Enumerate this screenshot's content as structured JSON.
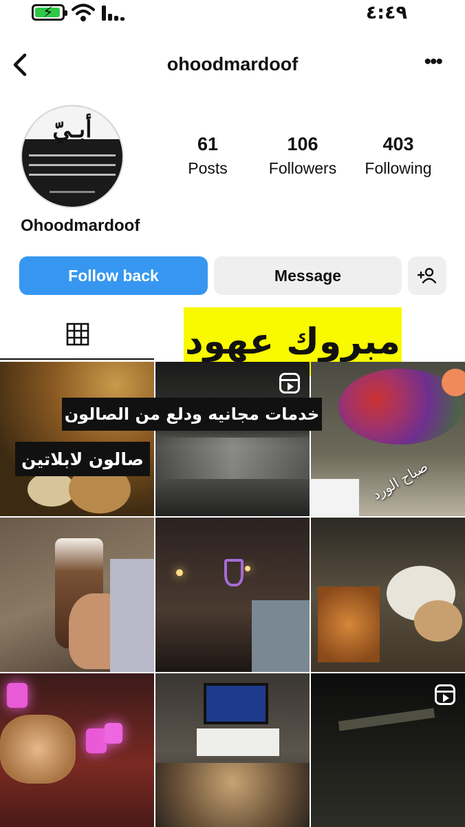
{
  "status_bar": {
    "time": "٤:٤٩",
    "battery_level": 0.85,
    "battery_charging": true,
    "icons": [
      "battery-icon",
      "wifi-icon",
      "cellular-signal-icon"
    ]
  },
  "header": {
    "username": "ohoodmardoof",
    "icons": [
      "back-arrow-icon",
      "more-options-icon"
    ]
  },
  "profile": {
    "avatar_text": "أبـيّ",
    "display_name": "Ohoodmardoof",
    "stats": [
      {
        "value": "61",
        "label": "Posts"
      },
      {
        "value": "106",
        "label": "Followers"
      },
      {
        "value": "403",
        "label": "Following"
      }
    ]
  },
  "actions": {
    "follow_back": "Follow back",
    "message": "Message",
    "add_person_icon": "person-add-icon"
  },
  "tabs": {
    "active": "grid-icon"
  },
  "overlays": {
    "congrats": "مبروك عهود",
    "services": "خدمات مجانيه ودلع من الصالون",
    "salon": "صالون لابلاتين",
    "photo_caption": "صباح الورد"
  },
  "colors": {
    "accent": "#3797f0",
    "secondary_button": "#efefef",
    "highlight": "#f9f900",
    "battery": "#2ec946"
  }
}
